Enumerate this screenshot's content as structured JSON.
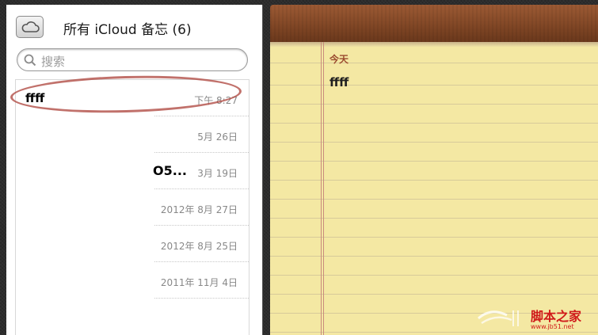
{
  "sidebar": {
    "title": "所有 iCloud 备忘 (6)",
    "cloud_button_icon": "cloud-icon",
    "search": {
      "placeholder": "搜索",
      "icon": "search-icon"
    },
    "notes": [
      {
        "title": "ffff",
        "date": "下午 8:27",
        "selected": true
      },
      {
        "title": "",
        "date": "5月 26日"
      },
      {
        "title": "O5...",
        "date": "3月 19日"
      },
      {
        "title": "",
        "date": "2012年 8月 27日"
      },
      {
        "title": "",
        "date": "2012年 8月 25日"
      },
      {
        "title": "",
        "date": "2011年 11月 4日"
      }
    ]
  },
  "note": {
    "date": "今天",
    "body": "ffff"
  },
  "watermark": {
    "main": "脚本之家",
    "sub": "www.jb51.net"
  },
  "colors": {
    "pad": "#f4e8a3",
    "leather": "#7a4222",
    "circle": "#b24e46",
    "margin_line": "#c98b7d"
  }
}
